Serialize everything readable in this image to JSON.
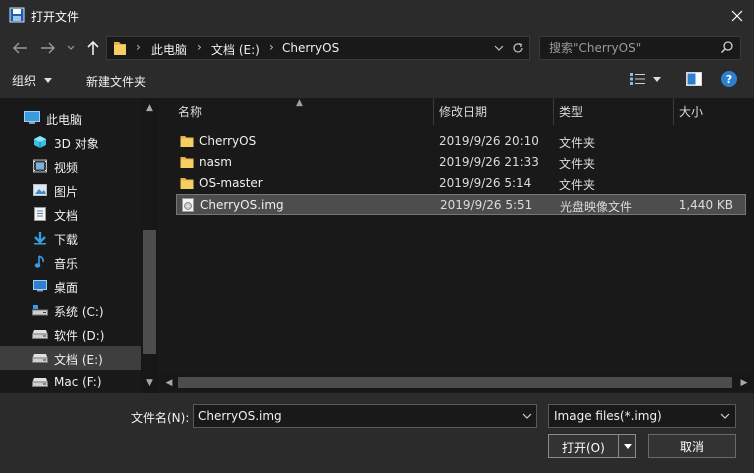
{
  "window": {
    "title": "打开文件",
    "accent_color": "#2f7fd0"
  },
  "address": {
    "segments": [
      "此电脑",
      "文档 (E:)",
      "CherryOS"
    ]
  },
  "search": {
    "placeholder": "搜索\"CherryOS\""
  },
  "toolbar": {
    "organize_label": "组织",
    "new_folder_label": "新建文件夹",
    "help_label": "?"
  },
  "sidebar": {
    "items": [
      {
        "label": "此电脑",
        "icon": "computer-icon"
      },
      {
        "label": "3D 对象",
        "icon": "3d-objects-icon"
      },
      {
        "label": "视频",
        "icon": "video-icon"
      },
      {
        "label": "图片",
        "icon": "pictures-icon"
      },
      {
        "label": "文档",
        "icon": "documents-icon"
      },
      {
        "label": "下载",
        "icon": "download-icon"
      },
      {
        "label": "音乐",
        "icon": "music-icon"
      },
      {
        "label": "桌面",
        "icon": "desktop-icon"
      },
      {
        "label": "系统 (C:)",
        "icon": "drive-icon"
      },
      {
        "label": "软件 (D:)",
        "icon": "drive-icon"
      },
      {
        "label": "文档 (E:)",
        "icon": "drive-icon",
        "selected": true
      },
      {
        "label": "Mac (F:)",
        "icon": "drive-icon"
      }
    ]
  },
  "filelist": {
    "columns": {
      "name": "名称",
      "date": "修改日期",
      "type": "类型",
      "size": "大小"
    },
    "rows": [
      {
        "name": "CherryOS",
        "date": "2019/9/26 20:10",
        "type": "文件夹",
        "size": "",
        "icon": "folder-icon"
      },
      {
        "name": "nasm",
        "date": "2019/9/26 21:33",
        "type": "文件夹",
        "size": "",
        "icon": "folder-icon"
      },
      {
        "name": "OS-master",
        "date": "2019/9/26 5:14",
        "type": "文件夹",
        "size": "",
        "icon": "folder-icon"
      },
      {
        "name": "CherryOS.img",
        "date": "2019/9/26 5:51",
        "type": "光盘映像文件",
        "size": "1,440 KB",
        "icon": "disc-image-icon",
        "selected": true
      }
    ]
  },
  "footer": {
    "filename_label": "文件名(N):",
    "filename_value": "CherryOS.img",
    "filter_value": "Image files(*.img)",
    "open_label": "打开(O)",
    "cancel_label": "取消"
  }
}
